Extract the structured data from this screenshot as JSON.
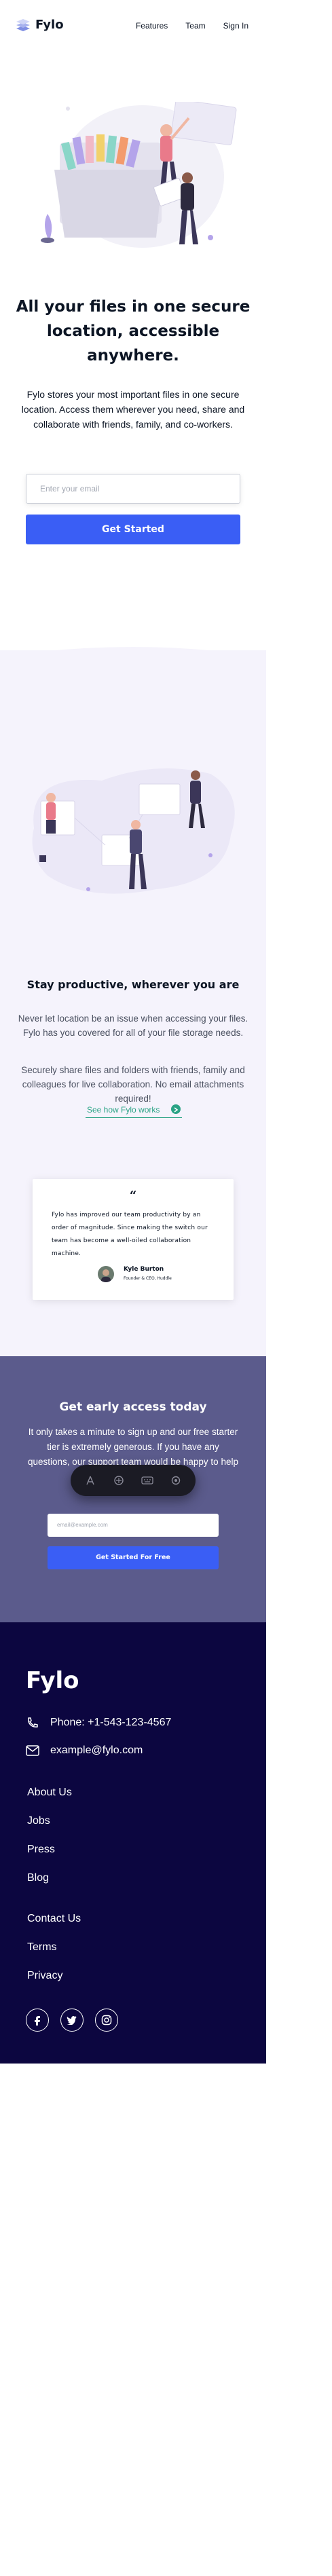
{
  "header": {
    "logo_text": "Fylo",
    "nav": [
      {
        "label": "Features"
      },
      {
        "label": "Team"
      },
      {
        "label": "Sign In"
      }
    ]
  },
  "hero": {
    "title": "All your files in one secure location, accessible anywhere.",
    "description": "Fylo stores your most important files in one secure location. Access them wherever you need, share and collaborate with friends, family, and co-workers.",
    "email_placeholder": "Enter your email",
    "cta_label": "Get Started"
  },
  "productive": {
    "title": "Stay productive, wherever you are",
    "paragraph_1": "Never let location be an issue when accessing your files. Fylo has you covered for all of your file storage needs.",
    "paragraph_2": "Securely share files and folders with friends, family and colleagues for live collaboration. No email attachments required!",
    "link_label": "See how Fylo works"
  },
  "testimonial": {
    "quote_mark": "“",
    "text": "Fylo has improved our team productivity by an order of magnitude. Since making the switch our team has become a well-oiled collaboration machine.",
    "name": "Kyle Burton",
    "role": "Founder & CEO, Huddle"
  },
  "early_access": {
    "title": "Get early access today",
    "description": "It only takes a minute to sign up and our free starter tier is extremely generous. If you have any questions, our support team would be happy to help you.",
    "email_placeholder": "email@example.com",
    "cta_label": "Get Started For Free"
  },
  "toolbar": {
    "items": [
      "accessibility-icon",
      "cursor-icon",
      "keyboard-icon",
      "settings-icon"
    ]
  },
  "footer": {
    "logo_text": "Fylo",
    "phone": "Phone: +1-543-123-4567",
    "email": "example@fylo.com",
    "links_1": [
      "About Us",
      "Jobs",
      "Press",
      "Blog"
    ],
    "links_2": [
      "Contact Us",
      "Terms",
      "Privacy"
    ],
    "social": [
      "facebook-icon",
      "twitter-icon",
      "instagram-icon"
    ]
  },
  "colors": {
    "accent_blue": "#3a5ef5",
    "link_green": "#2aa385",
    "early_bg": "#5b5b8c",
    "footer_bg": "#0c0640",
    "section_bg": "#f5f3fc"
  }
}
